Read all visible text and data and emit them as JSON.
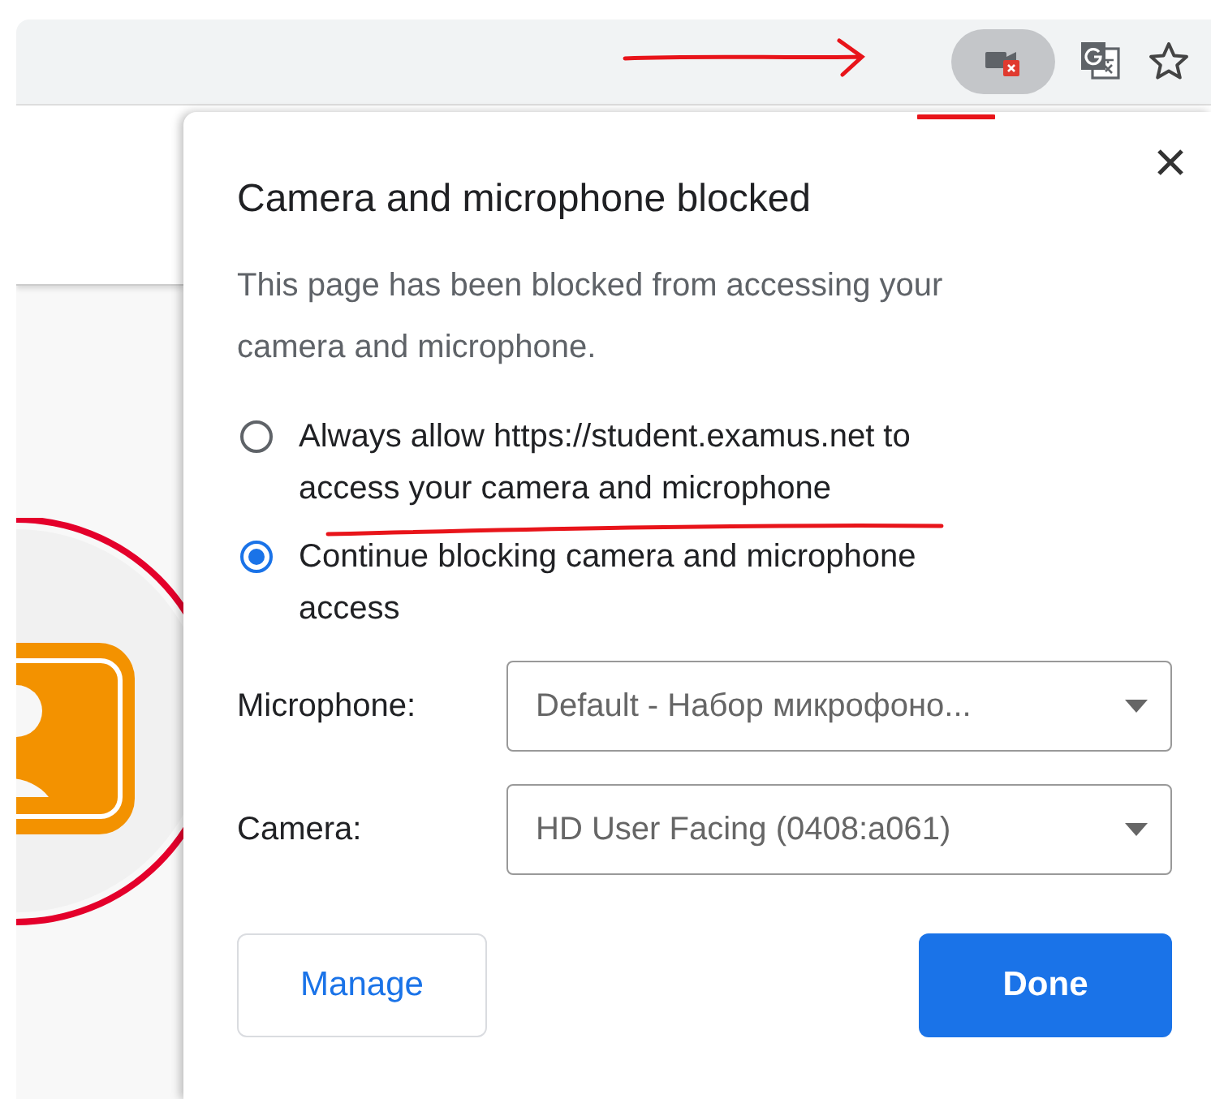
{
  "dialog": {
    "title": "Camera and microphone blocked",
    "description": "This page has been blocked from accessing your camera and microphone.",
    "options": [
      {
        "label": "Always allow https://student.examus.net to access your camera and microphone",
        "selected": false
      },
      {
        "label": "Continue blocking camera and microphone access",
        "selected": true
      }
    ],
    "fields": [
      {
        "label": "Microphone:",
        "value": "Default - Набор микрофоно..."
      },
      {
        "label": "Camera:",
        "value": "HD User Facing (0408:a061)"
      }
    ],
    "buttons": [
      {
        "label": "Manage",
        "kind": "secondary"
      },
      {
        "label": "Done",
        "kind": "primary"
      }
    ]
  }
}
